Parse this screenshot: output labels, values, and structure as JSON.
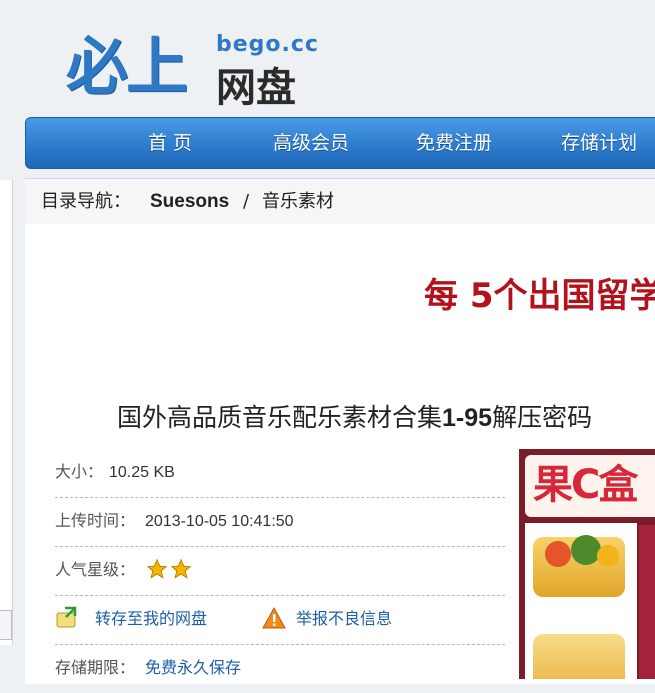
{
  "logo": {
    "mark": "必上",
    "sub": "网盘",
    "domain": "bego.cc"
  },
  "nav": {
    "items": [
      "首 页",
      "高级会员",
      "免费注册",
      "存储计划"
    ]
  },
  "breadcrumb": {
    "prefix": "目录导航：",
    "user": "Suesons",
    "separator": "/",
    "folder": "音乐素材"
  },
  "ad": {
    "text": "每 5个出国留学"
  },
  "file": {
    "title_pre": "国外高品质音乐配乐素材合集",
    "title_num": "1-95",
    "title_post": "解压密码",
    "size_label": "大小：",
    "size_value": "10.25 KB",
    "time_label": "上传时间：",
    "time_value": "2013-10-05 10:41:50",
    "rating_label": "人气星级：",
    "rating_stars": 2,
    "save_label": "转存至我的网盘",
    "report_label": "举报不良信息",
    "storage_label": "存储期限：",
    "storage_value": "免费永久保存"
  },
  "side_ad": {
    "brand_text": "果C盒"
  },
  "colors": {
    "nav": "#2d7ccd",
    "ad_red": "#b2121b",
    "link": "#1e5ea8",
    "star": "#f5b400"
  }
}
